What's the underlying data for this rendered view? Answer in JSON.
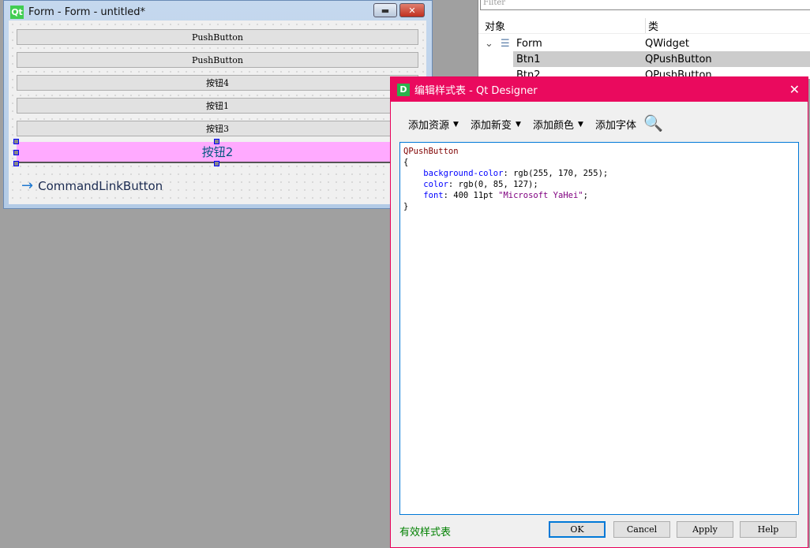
{
  "form_window": {
    "title": "Form - Form - untitled*",
    "buttons": [
      "PushButton",
      "PushButton",
      "按钮4",
      "按钮1",
      "按钮3"
    ],
    "selected_button": "按钮2",
    "command_link": "CommandLinkButton"
  },
  "object_inspector": {
    "filter_placeholder": "Filter",
    "headers": [
      "对象",
      "类"
    ],
    "rows": [
      {
        "name": "Form",
        "class": "QWidget"
      },
      {
        "name": "Btn1",
        "class": "QPushButton"
      },
      {
        "name": "Btn2",
        "class": "QPushButton"
      }
    ]
  },
  "dialog": {
    "title": "编辑样式表 - Qt Designer",
    "toolbar": [
      "添加资源",
      "添加新变",
      "添加颜色",
      "添加字体"
    ],
    "code": {
      "selector": "QPushButton",
      "open": "{",
      "close": "}",
      "props": [
        {
          "name": "background-color",
          "value": " rgb(255, 170, 255);"
        },
        {
          "name": "color",
          "value": " rgb(0, 85, 127);"
        },
        {
          "name": "font",
          "value": " 400 11pt ",
          "str": "\"Microsoft YaHei\"",
          "end": ";"
        }
      ]
    },
    "status": "有效样式表",
    "buttons": {
      "ok": "OK",
      "cancel": "Cancel",
      "apply": "Apply",
      "help": "Help"
    }
  },
  "colors": {
    "dialog_title": "#ea0a5e",
    "selected_bg": "#ffaaff",
    "selected_text": "#00557f",
    "status": "#008000"
  }
}
